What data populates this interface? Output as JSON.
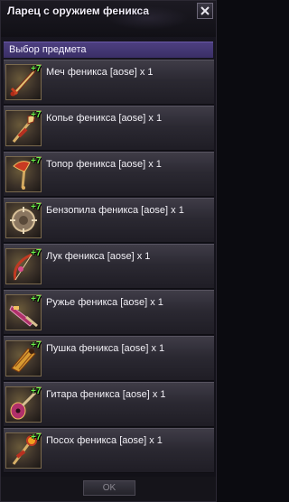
{
  "window": {
    "title": "Ларец с оружием феникса"
  },
  "section": {
    "header": "Выбор предмета"
  },
  "items": [
    {
      "label": "Меч феникса [aose] x 1",
      "plus": "+7",
      "icon": "sword-icon"
    },
    {
      "label": "Копье феникса [aose] x 1",
      "plus": "+7",
      "icon": "spear-icon"
    },
    {
      "label": "Топор феникса [aose] x 1",
      "plus": "+7",
      "icon": "axe-icon"
    },
    {
      "label": "Бензопила феникса [aose] x 1",
      "plus": "+7",
      "icon": "chainsaw-icon"
    },
    {
      "label": "Лук феникса [aose] x 1",
      "plus": "+7",
      "icon": "bow-icon"
    },
    {
      "label": "Ружье феникса [aose] x 1",
      "plus": "+7",
      "icon": "rifle-icon"
    },
    {
      "label": "Пушка феникса [aose] x 1",
      "plus": "+7",
      "icon": "cannon-icon"
    },
    {
      "label": "Гитара феникса [aose] x 1",
      "plus": "+7",
      "icon": "guitar-icon"
    },
    {
      "label": "Посох феникса [aose] x 1",
      "plus": "+7",
      "icon": "staff-icon"
    }
  ],
  "footer": {
    "ok_label": "OK"
  },
  "colors": {
    "accent": "#4d3f80",
    "plus": "#6cf04a"
  }
}
